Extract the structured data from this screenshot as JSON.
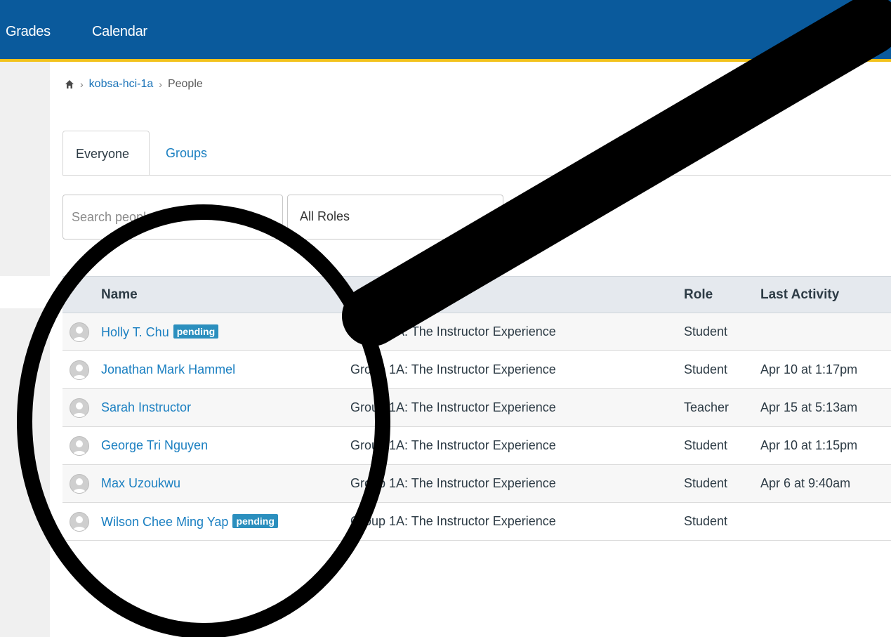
{
  "topbar": {
    "nav": [
      {
        "label": "Grades"
      },
      {
        "label": "Calendar"
      }
    ]
  },
  "breadcrumb": {
    "course": "kobsa-hci-1a",
    "page": "People"
  },
  "tabs": [
    {
      "label": "Everyone",
      "active": true
    },
    {
      "label": "Groups",
      "active": false
    }
  ],
  "filters": {
    "search_placeholder": "Search people",
    "role_selected": "All Roles"
  },
  "table": {
    "headers": {
      "name": "Name",
      "section": "",
      "role": "Role",
      "last_activity": "Last Activity"
    },
    "rows": [
      {
        "name": "Holly T. Chu",
        "badge": "pending",
        "section": "Group 1A: The Instructor Experience",
        "role": "Student",
        "last_activity": ""
      },
      {
        "name": "Jonathan Mark Hammel",
        "badge": "",
        "section": "Group 1A: The Instructor Experience",
        "role": "Student",
        "last_activity": "Apr 10 at 1:17pm"
      },
      {
        "name": "Sarah Instructor",
        "badge": "",
        "section": "Group 1A: The Instructor Experience",
        "role": "Teacher",
        "last_activity": "Apr 15 at 5:13am"
      },
      {
        "name": "George Tri Nguyen",
        "badge": "",
        "section": "Group 1A: The Instructor Experience",
        "role": "Student",
        "last_activity": "Apr 10 at 1:15pm"
      },
      {
        "name": "Max Uzoukwu",
        "badge": "",
        "section": "Group 1A: The Instructor Experience",
        "role": "Student",
        "last_activity": "Apr 6 at 9:40am"
      },
      {
        "name": "Wilson Chee Ming Yap",
        "badge": "pending",
        "section": "Group 1A: The Instructor Experience",
        "role": "Student",
        "last_activity": ""
      }
    ]
  },
  "colors": {
    "topbar": "#0a5a9c",
    "topbar_border": "#f2c21b",
    "link": "#1a7fc1",
    "badge": "#2b8fbe"
  }
}
